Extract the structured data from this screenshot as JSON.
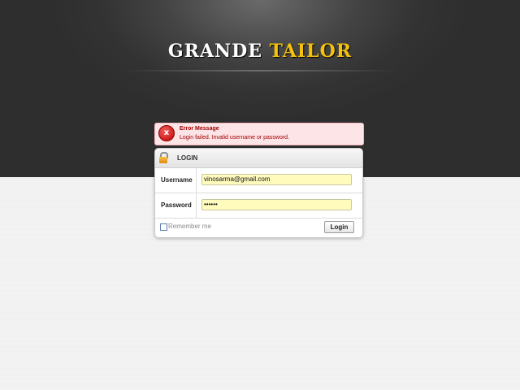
{
  "logo": {
    "word1": "GRANDE",
    "word2": "TAILOR"
  },
  "error": {
    "icon": "error-x-icon",
    "icon_glyph": "x",
    "title": "Error Message",
    "text": "Login failed. Invalid username or password."
  },
  "login": {
    "icon": "lock-icon",
    "title": "LOGIN",
    "username_label": "Username",
    "username_value": "vinosarma@gmail.com",
    "password_label": "Password",
    "password_value": "secret",
    "remember_label": "Remember me",
    "remember_checked": false,
    "button_label": "Login"
  },
  "colors": {
    "header_dark": "#333333",
    "logo_accent": "#f4c20d",
    "error_text": "#a30000",
    "error_bg": "#fde4e6",
    "field_bg": "#fefbbd"
  }
}
